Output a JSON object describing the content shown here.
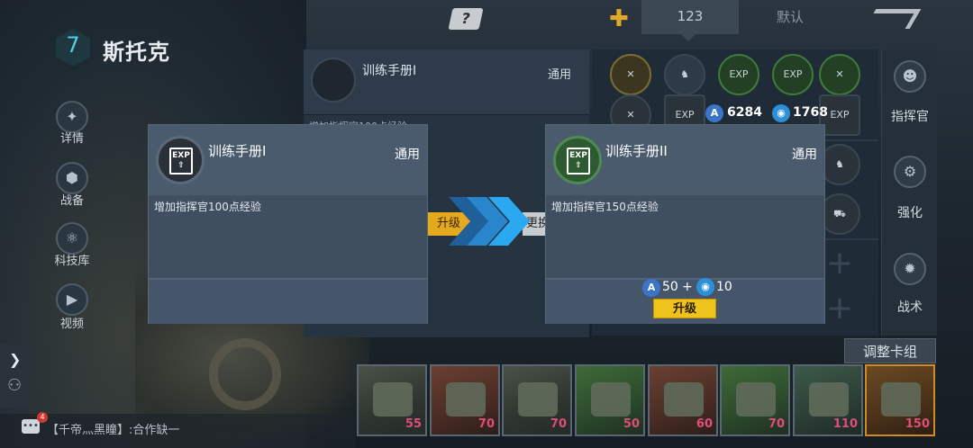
{
  "commander": {
    "level": "7",
    "name": "斯托克"
  },
  "left_nav": [
    {
      "label": "详情",
      "icon": "details-icon"
    },
    {
      "label": "战备",
      "icon": "equipment-icon"
    },
    {
      "label": "科技库",
      "icon": "tech-library-icon"
    },
    {
      "label": "视频",
      "icon": "video-icon"
    }
  ],
  "top_bar": {
    "help": "?",
    "tab_value": "123",
    "default_label": "默认"
  },
  "background_panel": {
    "item_title": "训练手册I",
    "item_tag": "通用",
    "item_desc": "增加指挥官100点经验",
    "upgrade_label": "升级",
    "change_label": "更换"
  },
  "resources": {
    "blue_crystal": "6284",
    "blue_orb": "1768"
  },
  "right_nav": [
    {
      "label": "指挥官",
      "icon": "commander-icon"
    },
    {
      "label": "强化",
      "icon": "enhance-icon"
    },
    {
      "label": "战术",
      "icon": "tactics-icon"
    }
  ],
  "adjust_deck_label": "调整卡组",
  "chat": {
    "badge": "4",
    "text": "【千帝灬黑瞳】:合作缺一"
  },
  "deck_cards": [
    {
      "cost": "55"
    },
    {
      "cost": "70"
    },
    {
      "cost": "70"
    },
    {
      "cost": "50"
    },
    {
      "cost": "60"
    },
    {
      "cost": "70"
    },
    {
      "cost": "110"
    },
    {
      "cost": "150"
    }
  ],
  "exp_label": "EXP",
  "popup_current": {
    "title": "训练手册I",
    "tag": "通用",
    "desc": "增加指挥官100点经验"
  },
  "popup_next": {
    "title": "训练手册II",
    "tag": "通用",
    "desc": "增加指挥官150点经验",
    "cost_a": "50",
    "plus": "+",
    "cost_b": "10",
    "upgrade_label": "升级"
  },
  "colors": {
    "accent_yellow": "#f0c21c",
    "arrow_blue": "#2aa8f0",
    "cost_pink": "#e04d7a"
  }
}
